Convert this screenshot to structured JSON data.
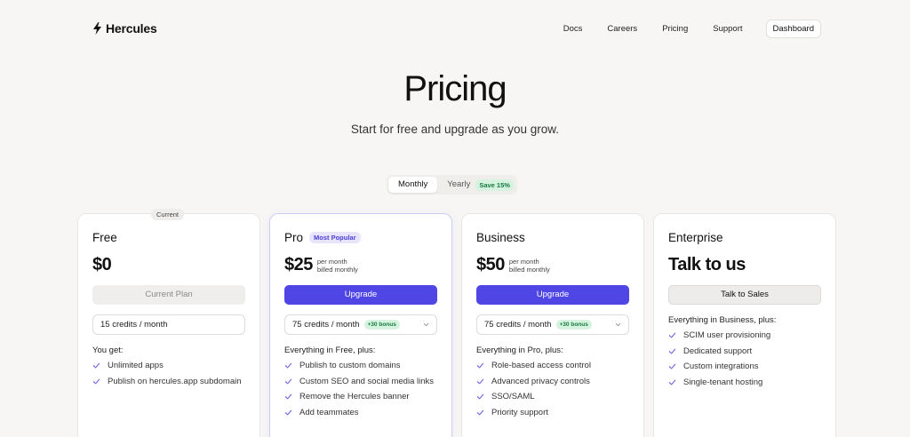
{
  "brand": {
    "name": "Hercules"
  },
  "nav": {
    "links": [
      "Docs",
      "Careers",
      "Pricing",
      "Support"
    ],
    "dashboard": "Dashboard"
  },
  "hero": {
    "title": "Pricing",
    "subtitle": "Start for free and upgrade as you grow."
  },
  "billing_toggle": {
    "monthly": "Monthly",
    "yearly": "Yearly",
    "save_badge": "Save 15%",
    "selected": "Monthly"
  },
  "colors": {
    "accent": "#5046e5",
    "bonus_green": "#167a3f",
    "check": "#6b66e0"
  },
  "plans": [
    {
      "current_tag": "Current",
      "name": "Free",
      "price": "$0",
      "button": "Current Plan",
      "credits": "15 credits / month",
      "features_title": "You get:",
      "features": [
        "Unlimited apps",
        "Publish on hercules.app subdomain"
      ]
    },
    {
      "name": "Pro",
      "badge": "Most Popular",
      "price": "$25",
      "price_note_1": "per month",
      "price_note_2": "billed monthly",
      "button": "Upgrade",
      "credits": "75 credits / month",
      "bonus": "+30 bonus",
      "features_title": "Everything in Free, plus:",
      "features": [
        "Publish to custom domains",
        "Custom SEO and social media links",
        "Remove the Hercules banner",
        "Add teammates"
      ]
    },
    {
      "name": "Business",
      "price": "$50",
      "price_note_1": "per month",
      "price_note_2": "billed monthly",
      "button": "Upgrade",
      "credits": "75 credits / month",
      "bonus": "+30 bonus",
      "features_title": "Everything in Pro, plus:",
      "features": [
        "Role-based access control",
        "Advanced privacy controls",
        "SSO/SAML",
        "Priority support"
      ]
    },
    {
      "name": "Enterprise",
      "price": "Talk to us",
      "button": "Talk to Sales",
      "features_title": "Everything in Business, plus:",
      "features": [
        "SCIM user provisioning",
        "Dedicated support",
        "Custom integrations",
        "Single-tenant hosting"
      ]
    }
  ]
}
